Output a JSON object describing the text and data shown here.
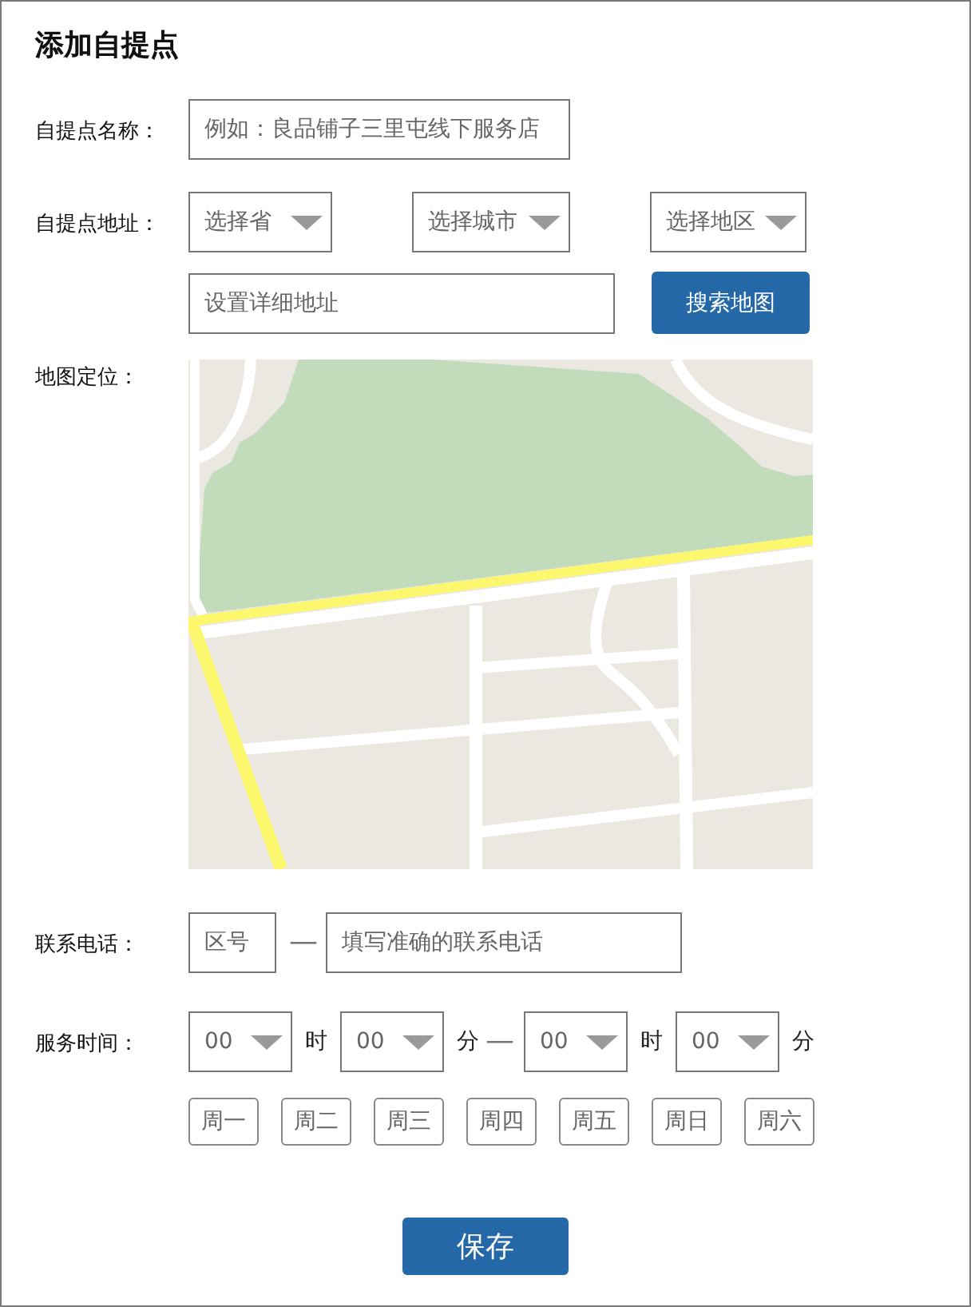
{
  "title": "添加自提点",
  "name_field": {
    "label": "自提点名称：",
    "placeholder": "例如：良品铺子三里屯线下服务店"
  },
  "address": {
    "label": "自提点地址：",
    "selects": [
      {
        "value": "选择省"
      },
      {
        "value": "选择城市"
      },
      {
        "value": "选择地区"
      }
    ],
    "detail": {
      "placeholder": "设置详细地址"
    },
    "search_button": "搜索地图"
  },
  "map": {
    "label": "地图定位："
  },
  "phone": {
    "label": "联系电话：",
    "area_code": {
      "placeholder": "区号"
    },
    "separator": "—",
    "number": {
      "placeholder": "填写准确的联系电话"
    }
  },
  "service_time": {
    "label": "服务时间：",
    "start": {
      "hour": "00",
      "hour_unit": "时",
      "minute": "00",
      "minute_unit": "分"
    },
    "separator": "—",
    "end": {
      "hour": "00",
      "hour_unit": "时",
      "minute": "00",
      "minute_unit": "分"
    },
    "days": [
      {
        "label": "周一",
        "selected": false
      },
      {
        "label": "周二",
        "selected": false
      },
      {
        "label": "周三",
        "selected": false
      },
      {
        "label": "周四",
        "selected": false
      },
      {
        "label": "周五",
        "selected": false
      },
      {
        "label": "周日",
        "selected": false
      },
      {
        "label": "周六",
        "selected": false
      }
    ]
  },
  "save_button": "保存"
}
